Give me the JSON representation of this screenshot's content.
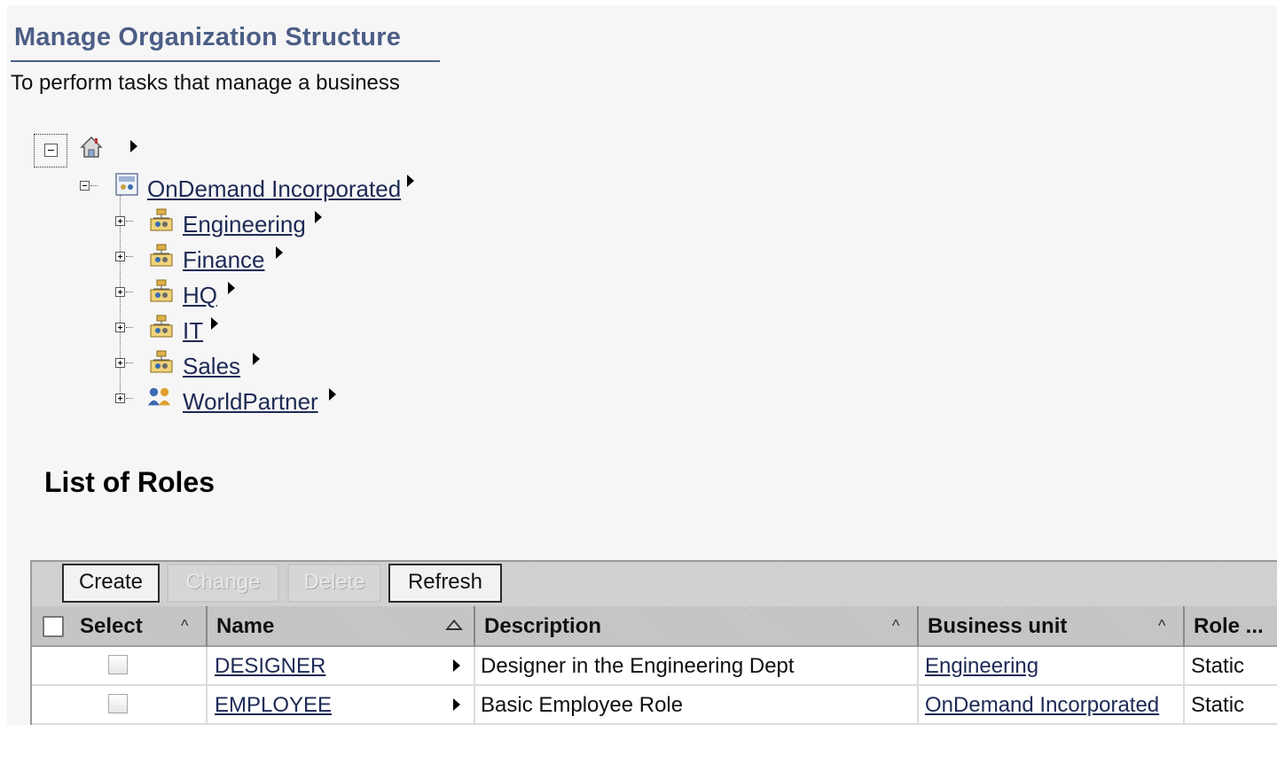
{
  "page": {
    "title": "Manage Organization Structure",
    "subtitle": "To perform tasks that manage a business"
  },
  "tree": {
    "root_icon": "home-icon",
    "root": {
      "label": "OnDemand Incorporated",
      "icon": "organization-icon",
      "expanded": true
    },
    "children": [
      {
        "label": "Engineering",
        "icon": "org-unit-icon"
      },
      {
        "label": "Finance",
        "icon": "org-unit-icon"
      },
      {
        "label": "HQ",
        "icon": "org-unit-icon"
      },
      {
        "label": "IT",
        "icon": "org-unit-icon"
      },
      {
        "label": "Sales",
        "icon": "org-unit-icon"
      },
      {
        "label": "WorldPartner",
        "icon": "partner-group-icon"
      }
    ]
  },
  "roles": {
    "section_title": "List of Roles",
    "toolbar": {
      "create": "Create",
      "change": "Change",
      "delete": "Delete",
      "refresh": "Refresh"
    },
    "columns": {
      "select": "Select",
      "name": "Name",
      "description": "Description",
      "business_unit": "Business unit",
      "role_type": "Role ..."
    },
    "sort_caret": "^",
    "rows": [
      {
        "name": "DESIGNER",
        "description": "Designer in the Engineering Dept",
        "business_unit": "Engineering",
        "role_type": "Static"
      },
      {
        "name": "EMPLOYEE",
        "description": "Basic Employee Role",
        "business_unit": "OnDemand Incorporated",
        "role_type": "Static"
      }
    ]
  },
  "colors": {
    "title": "#4c5e86",
    "link": "#1e2a55",
    "background": "#f6f6f6"
  }
}
